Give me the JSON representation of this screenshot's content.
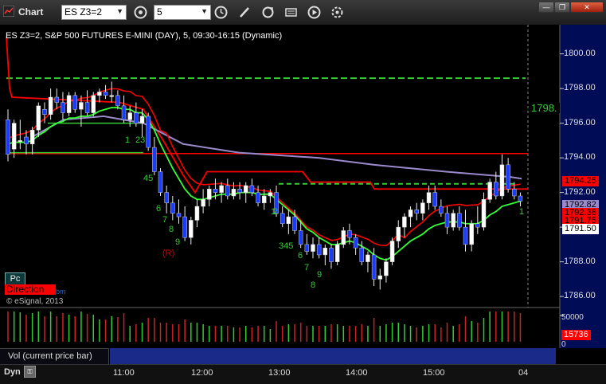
{
  "window": {
    "title": "Chart"
  },
  "toolbar": {
    "symbol": "ES Z3=2",
    "interval": "5",
    "icons": [
      "settings-icon",
      "clock-icon",
      "pencil-icon",
      "refresh-icon",
      "quote-icon",
      "play-icon",
      "tools-icon"
    ]
  },
  "header": {
    "text": "ES Z3=2, S&P 500 FUTURES E-MINI (DAY), 5, 09:30-16:15 (Dynamic)"
  },
  "yaxis": {
    "min": 1785.5,
    "max": 1801.5,
    "ticks": [
      "1800.00",
      "1798.00",
      "1796.00",
      "1794.00",
      "1792.00",
      "1790.00",
      "1788.00",
      "1786.00"
    ]
  },
  "price_tags": [
    {
      "text": "1798.",
      "bg": "#000000",
      "fg": "#33cc33"
    },
    {
      "text": "1794.25",
      "bg": "#ff0000",
      "fg": "#000000"
    },
    {
      "text": "1792.82",
      "bg": "#9a8acb",
      "fg": "#000000"
    },
    {
      "text": "1792.38",
      "bg": "#ff0000",
      "fg": "#000000"
    },
    {
      "text": "1791.75",
      "bg": "#ff0000",
      "fg": "#000000"
    },
    {
      "text": "1791.50",
      "bg": "#ffffff",
      "fg": "#000000"
    }
  ],
  "xaxis": {
    "ticks": [
      "11:00",
      "12:00",
      "13:00",
      "14:00",
      "15:00",
      "04"
    ]
  },
  "annotations": [
    "1",
    "23",
    "45",
    "6",
    "7",
    "8",
    "9",
    "(R)",
    "1",
    "2",
    "345",
    "6",
    "7",
    "8",
    "9",
    "1"
  ],
  "legend": {
    "pc": "Pc",
    "direction": "Direction",
    "direction_suffix": "bm",
    "copyright": "© eSignal, 2013"
  },
  "volume": {
    "label": "Vol (current price bar)",
    "max_label": "50000",
    "zero_label": "0",
    "current": "15736"
  },
  "statusbar": {
    "mode": "Dyn"
  },
  "colors": {
    "up": "#ffffff",
    "down": "#1a3cff",
    "red_line": "#ff0000",
    "green_line": "#33ff33",
    "purple_line": "#9a8acb",
    "axis_bg": "#000c55"
  },
  "chart_data": {
    "type": "candlestick",
    "bars": [
      [
        1796.2,
        1796.8,
        1793.8,
        1794.2
      ],
      [
        1794.5,
        1796.2,
        1794.0,
        1796.0
      ],
      [
        1795.0,
        1796.2,
        1794.5,
        1795.0
      ],
      [
        1795.2,
        1795.6,
        1794.2,
        1794.8
      ],
      [
        1794.8,
        1795.8,
        1794.2,
        1795.6
      ],
      [
        1795.6,
        1797.2,
        1795.2,
        1797.0
      ],
      [
        1796.8,
        1797.2,
        1796.0,
        1796.5
      ],
      [
        1796.5,
        1798.0,
        1796.2,
        1797.5
      ],
      [
        1797.5,
        1798.0,
        1796.8,
        1797.2
      ],
      [
        1797.2,
        1797.8,
        1796.2,
        1796.6
      ],
      [
        1796.6,
        1797.8,
        1796.4,
        1797.6
      ],
      [
        1797.6,
        1797.8,
        1796.6,
        1796.8
      ],
      [
        1796.8,
        1797.6,
        1795.8,
        1797.2
      ],
      [
        1797.2,
        1797.9,
        1796.4,
        1796.6
      ],
      [
        1796.6,
        1797.8,
        1796.4,
        1797.6
      ],
      [
        1797.6,
        1798.0,
        1797.2,
        1797.8
      ],
      [
        1797.8,
        1798.2,
        1797.4,
        1797.6
      ],
      [
        1797.6,
        1798.4,
        1797.2,
        1797.6
      ],
      [
        1797.6,
        1797.9,
        1796.8,
        1797.0
      ],
      [
        1797.0,
        1797.6,
        1796.0,
        1796.2
      ],
      [
        1796.2,
        1797.0,
        1795.8,
        1796.6
      ],
      [
        1796.6,
        1797.2,
        1795.8,
        1796.0
      ],
      [
        1796.0,
        1796.8,
        1795.2,
        1796.4
      ],
      [
        1796.4,
        1796.6,
        1794.4,
        1794.6
      ],
      [
        1794.6,
        1795.2,
        1793.0,
        1793.2
      ],
      [
        1793.2,
        1793.4,
        1791.8,
        1792.0
      ],
      [
        1792.0,
        1792.4,
        1790.8,
        1791.4
      ],
      [
        1791.4,
        1791.8,
        1790.4,
        1790.8
      ],
      [
        1790.8,
        1791.6,
        1790.2,
        1790.6
      ],
      [
        1790.6,
        1791.2,
        1789.2,
        1789.4
      ],
      [
        1789.4,
        1790.6,
        1789.0,
        1790.4
      ],
      [
        1790.4,
        1791.6,
        1790.0,
        1791.2
      ],
      [
        1791.2,
        1792.2,
        1790.8,
        1791.6
      ],
      [
        1791.6,
        1792.4,
        1791.2,
        1792.2
      ],
      [
        1792.2,
        1792.8,
        1791.6,
        1792.0
      ],
      [
        1792.0,
        1792.6,
        1791.4,
        1792.4
      ],
      [
        1792.4,
        1792.8,
        1791.6,
        1791.8
      ],
      [
        1791.8,
        1792.6,
        1791.6,
        1792.2
      ],
      [
        1792.2,
        1792.6,
        1791.6,
        1792.0
      ],
      [
        1792.0,
        1792.6,
        1791.4,
        1792.4
      ],
      [
        1792.4,
        1792.8,
        1791.8,
        1792.0
      ],
      [
        1792.0,
        1792.4,
        1791.2,
        1791.4
      ],
      [
        1791.4,
        1792.2,
        1791.0,
        1791.8
      ],
      [
        1791.8,
        1792.2,
        1791.4,
        1792.0
      ],
      [
        1792.0,
        1792.4,
        1790.6,
        1790.8
      ],
      [
        1790.8,
        1791.2,
        1790.0,
        1790.2
      ],
      [
        1790.2,
        1791.0,
        1789.6,
        1790.6
      ],
      [
        1790.6,
        1791.0,
        1789.6,
        1789.8
      ],
      [
        1789.8,
        1790.4,
        1788.8,
        1789.0
      ],
      [
        1789.0,
        1789.6,
        1788.4,
        1788.6
      ],
      [
        1788.6,
        1789.4,
        1788.2,
        1789.0
      ],
      [
        1789.0,
        1789.4,
        1788.2,
        1788.4
      ],
      [
        1788.4,
        1789.0,
        1787.8,
        1788.8
      ],
      [
        1788.8,
        1789.0,
        1787.6,
        1788.0
      ],
      [
        1788.0,
        1789.2,
        1787.8,
        1789.0
      ],
      [
        1789.0,
        1790.0,
        1788.8,
        1789.8
      ],
      [
        1789.8,
        1790.2,
        1789.0,
        1789.4
      ],
      [
        1789.4,
        1789.6,
        1788.4,
        1788.8
      ],
      [
        1788.8,
        1789.2,
        1787.8,
        1788.0
      ],
      [
        1788.0,
        1788.6,
        1787.4,
        1788.4
      ],
      [
        1788.4,
        1788.8,
        1786.6,
        1787.0
      ],
      [
        1787.0,
        1787.6,
        1786.4,
        1787.2
      ],
      [
        1787.2,
        1788.2,
        1786.8,
        1788.0
      ],
      [
        1788.0,
        1789.4,
        1787.8,
        1789.2
      ],
      [
        1789.2,
        1790.4,
        1788.8,
        1790.0
      ],
      [
        1790.0,
        1790.8,
        1789.4,
        1790.6
      ],
      [
        1790.6,
        1791.2,
        1790.0,
        1791.0
      ],
      [
        1791.0,
        1791.4,
        1790.4,
        1790.8
      ],
      [
        1790.8,
        1791.6,
        1790.4,
        1791.4
      ],
      [
        1791.4,
        1792.4,
        1791.0,
        1792.0
      ],
      [
        1792.0,
        1792.4,
        1791.0,
        1791.2
      ],
      [
        1791.2,
        1791.6,
        1790.6,
        1790.8
      ],
      [
        1790.8,
        1791.2,
        1789.6,
        1790.0
      ],
      [
        1790.0,
        1791.0,
        1789.8,
        1790.8
      ],
      [
        1790.8,
        1791.2,
        1789.8,
        1790.0
      ],
      [
        1790.0,
        1791.0,
        1788.6,
        1789.0
      ],
      [
        1789.0,
        1790.4,
        1788.6,
        1790.2
      ],
      [
        1790.2,
        1791.2,
        1789.6,
        1790.0
      ],
      [
        1790.0,
        1792.0,
        1789.8,
        1791.6
      ],
      [
        1791.6,
        1792.8,
        1791.4,
        1792.6
      ],
      [
        1792.6,
        1793.2,
        1791.6,
        1791.8
      ],
      [
        1791.8,
        1794.2,
        1791.6,
        1793.6
      ],
      [
        1793.6,
        1794.0,
        1792.0,
        1792.2
      ],
      [
        1792.2,
        1792.6,
        1791.6,
        1791.8
      ],
      [
        1791.8,
        1792.0,
        1791.2,
        1791.5
      ]
    ],
    "ema_green": [
      1794.8,
      1794.9,
      1794.9,
      1794.9,
      1795.0,
      1795.3,
      1795.5,
      1795.8,
      1796.0,
      1796.1,
      1796.3,
      1796.3,
      1796.4,
      1796.4,
      1796.5,
      1796.7,
      1796.8,
      1796.9,
      1796.9,
      1796.8,
      1796.8,
      1796.6,
      1796.6,
      1796.2,
      1795.6,
      1794.8,
      1794.1,
      1793.4,
      1792.8,
      1792.2,
      1791.8,
      1791.6,
      1791.6,
      1791.7,
      1791.8,
      1791.9,
      1791.9,
      1791.9,
      1792.0,
      1792.0,
      1792.0,
      1791.9,
      1791.9,
      1791.9,
      1791.6,
      1791.3,
      1791.0,
      1790.7,
      1790.3,
      1789.9,
      1789.7,
      1789.4,
      1789.2,
      1789.0,
      1789.0,
      1789.1,
      1789.2,
      1789.1,
      1788.9,
      1788.7,
      1788.4,
      1788.2,
      1788.1,
      1788.3,
      1788.6,
      1788.9,
      1789.2,
      1789.4,
      1789.6,
      1789.9,
      1790.1,
      1790.2,
      1790.3,
      1790.3,
      1790.3,
      1790.2,
      1790.2,
      1790.2,
      1790.4,
      1790.7,
      1790.9,
      1791.2,
      1791.3,
      1791.4,
      1791.5
    ]
  }
}
